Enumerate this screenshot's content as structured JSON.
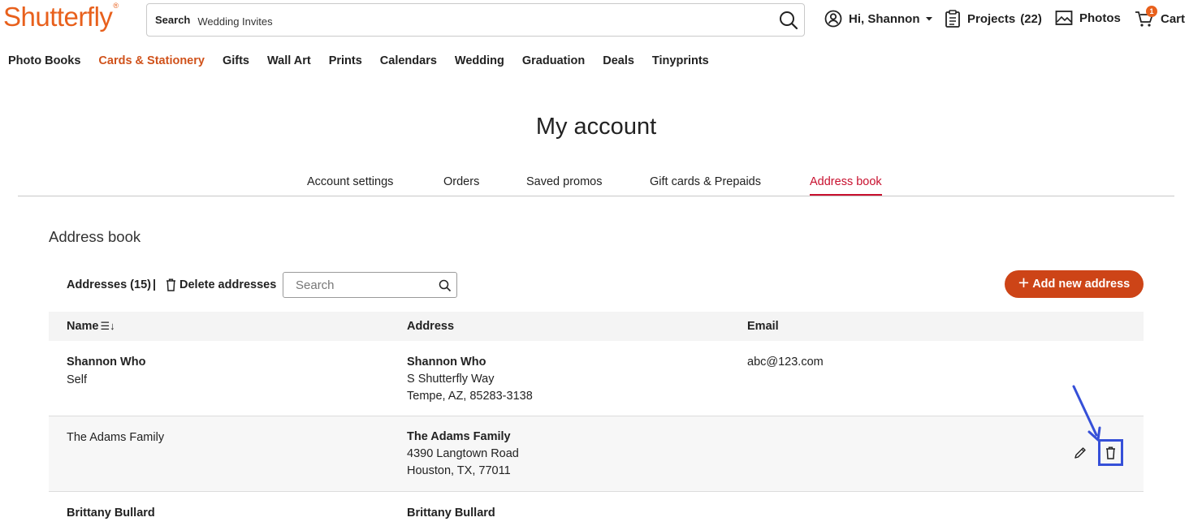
{
  "brand": {
    "name": "Shutterfly",
    "reg": "®",
    "color": "#e8601c"
  },
  "search": {
    "label": "Search",
    "value": "Wedding Invites"
  },
  "header": {
    "greeting": "Hi, Shannon",
    "projects": "Projects",
    "projects_count": "(22)",
    "photos": "Photos",
    "cart": "Cart",
    "cart_badge": "1"
  },
  "nav": [
    "Photo Books",
    "Cards & Stationery",
    "Gifts",
    "Wall Art",
    "Prints",
    "Calendars",
    "Wedding",
    "Graduation",
    "Deals",
    "Tinyprints"
  ],
  "page": {
    "title": "My account"
  },
  "tabs": [
    "Account settings",
    "Orders",
    "Saved promos",
    "Gift cards & Prepaids",
    "Address book"
  ],
  "active_tab": "Address book",
  "address_book": {
    "title": "Address book",
    "count_label": "Addresses (15)",
    "separator": "|",
    "delete_label": "Delete addresses",
    "search_placeholder": "Search",
    "add_label": "Add new address",
    "columns": {
      "name": "Name",
      "address": "Address",
      "email": "Email"
    },
    "rows": [
      {
        "name": "Shannon Who",
        "relation": "Self",
        "addr_name": "Shannon Who",
        "addr_line1": "S Shutterfly Way",
        "addr_line2": "Tempe, AZ, 85283-3138",
        "email": "abc@123.com"
      },
      {
        "name": "The Adams Family",
        "relation": "",
        "addr_name": "The Adams Family",
        "addr_line1": "4390 Langtown Road",
        "addr_line2": "Houston, TX, 77011",
        "email": ""
      },
      {
        "name": "Brittany Bullard",
        "relation": "",
        "addr_name": "Brittany Bullard",
        "addr_line1": "",
        "addr_line2": "",
        "email": ""
      }
    ]
  },
  "colors": {
    "accent": "#cd4417",
    "active_tab": "#c8102e",
    "highlight": "#3650d8"
  }
}
